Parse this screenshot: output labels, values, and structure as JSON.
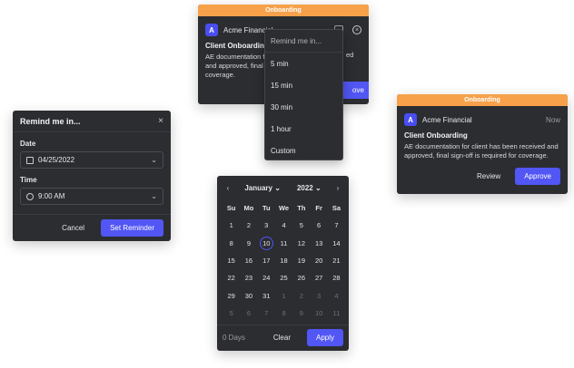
{
  "colors": {
    "header_orange": "#f7a14a",
    "primary": "#5156f4",
    "panel": "#2b2d31"
  },
  "notif_top": {
    "header": "Onboarding",
    "app": "Acme Financial",
    "title": "Client Onboarding",
    "text": "AE documentation f... received and approved, final ... coverage.",
    "text_lines": [
      "AE documentation f",
      "and approved, final",
      "coverage."
    ],
    "text_right": "ed",
    "approve_label": "ove",
    "logo_letter": "A"
  },
  "notif_right": {
    "header": "Onboarding",
    "app": "Acme Financial",
    "time": "Now",
    "title": "Client Onboarding",
    "text": "AE documentation for client has been received and approved, final sign-off is required for coverage.",
    "review_label": "Review",
    "approve_label": "Approve",
    "logo_letter": "A"
  },
  "remind_menu": {
    "heading": "Remind me in...",
    "items": [
      "5 min",
      "15 min",
      "30 min",
      "1 hour",
      "Custom"
    ]
  },
  "remind_dialog": {
    "title": "Remind me in...",
    "date_label": "Date",
    "date_value": "04/25/2022",
    "time_label": "Time",
    "time_value": "9:00 AM",
    "cancel_label": "Cancel",
    "submit_label": "Set Reminder"
  },
  "calendar": {
    "month": "January",
    "year": "2022",
    "weekdays": [
      "Su",
      "Mo",
      "Tu",
      "We",
      "Th",
      "Fr",
      "Sa"
    ],
    "weeks": [
      [
        "1",
        "2",
        "3",
        "4",
        "5",
        "6",
        "7"
      ],
      [
        "8",
        "9",
        "10",
        "11",
        "12",
        "13",
        "14"
      ],
      [
        "15",
        "16",
        "17",
        "18",
        "19",
        "20",
        "21"
      ],
      [
        "22",
        "23",
        "24",
        "25",
        "26",
        "27",
        "28"
      ],
      [
        "29",
        "30",
        "31",
        "1",
        "2",
        "3",
        "4"
      ],
      [
        "5",
        "6",
        "7",
        "8",
        "9",
        "10",
        "11"
      ]
    ],
    "today": "10",
    "days_label": "0 Days",
    "clear_label": "Clear",
    "apply_label": "Apply"
  }
}
